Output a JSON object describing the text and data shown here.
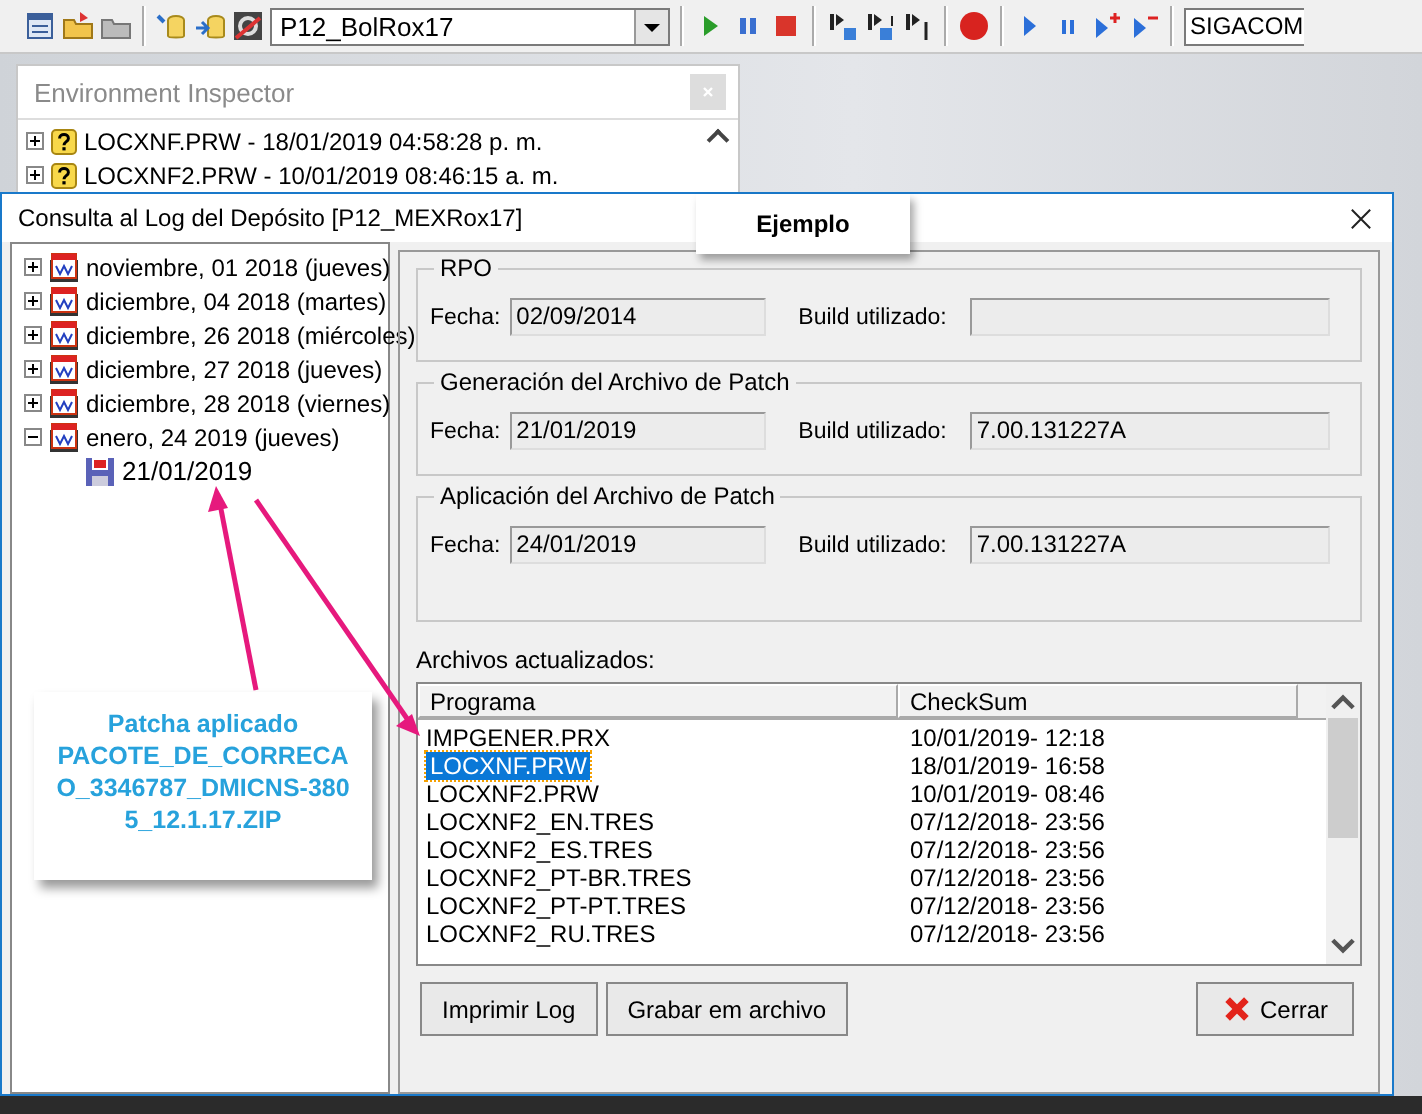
{
  "toolbar": {
    "environment_select": "P12_BolRox17",
    "server_field": "SIGACOM"
  },
  "environment_inspector": {
    "title": "Environment Inspector",
    "items": [
      {
        "label": "LOCXNF.PRW - 18/01/2019 04:58:28 p. m.",
        "expanded": false
      },
      {
        "label": "LOCXNF2.PRW - 10/01/2019 08:46:15 a. m.",
        "expanded": false
      }
    ]
  },
  "dialog": {
    "title": "Consulta al Log del Depósito [P12_MEXRox17]",
    "tree": [
      {
        "label": "noviembre, 01 2018 (jueves)",
        "expanded": false
      },
      {
        "label": "diciembre, 04 2018 (martes)",
        "expanded": false
      },
      {
        "label": "diciembre, 26 2018 (miércoles)",
        "expanded": false
      },
      {
        "label": "diciembre, 27 2018 (jueves)",
        "expanded": false
      },
      {
        "label": "diciembre, 28 2018 (viernes)",
        "expanded": false
      },
      {
        "label": "enero, 24 2019 (jueves)",
        "expanded": true,
        "children": [
          {
            "label": "21/01/2019"
          }
        ]
      }
    ],
    "groups": [
      {
        "title": "RPO",
        "date_label": "Fecha:",
        "date": "02/09/2014",
        "build_label": "Build utilizado:"
      },
      {
        "title": "Generación del Archivo de Patch",
        "date_label": "Fecha:",
        "date": "21/01/2019",
        "build_label": "Build utilizado:",
        "build": "7.00.131227A"
      },
      {
        "title": "Aplicación del Archivo de Patch",
        "date_label": "Fecha:",
        "date": "24/01/2019",
        "build_label": "Build utilizado:",
        "build": "7.00.131227A"
      }
    ],
    "files_label": "Archivos actualizados:",
    "table": {
      "columns": [
        "Programa",
        "CheckSum"
      ],
      "rows": [
        {
          "cells": [
            "IMPGENER.PRX",
            "10/01/2019- 12:18"
          ],
          "selected": false
        },
        {
          "cells": [
            "LOCXNF.PRW",
            "18/01/2019- 16:58"
          ],
          "selected": true
        },
        {
          "cells": [
            "LOCXNF2.PRW",
            "10/01/2019- 08:46"
          ],
          "selected": false
        },
        {
          "cells": [
            "LOCXNF2_EN.TRES",
            "07/12/2018- 23:56"
          ],
          "selected": false
        },
        {
          "cells": [
            "LOCXNF2_ES.TRES",
            "07/12/2018- 23:56"
          ],
          "selected": false
        },
        {
          "cells": [
            "LOCXNF2_PT-BR.TRES",
            "07/12/2018- 23:56"
          ],
          "selected": false
        },
        {
          "cells": [
            "LOCXNF2_PT-PT.TRES",
            "07/12/2018- 23:56"
          ],
          "selected": false
        },
        {
          "cells": [
            "LOCXNF2_RU.TRES",
            "07/12/2018- 23:56"
          ],
          "selected": false
        }
      ]
    },
    "buttons": [
      {
        "label": "Imprimir Log",
        "kind": "plain"
      },
      {
        "label": "Grabar em archivo",
        "kind": "plain"
      },
      {
        "label": "Cerrar",
        "kind": "close"
      }
    ]
  },
  "annotations": [
    {
      "kind": "tag",
      "text": "Ejemplo"
    },
    {
      "kind": "callout",
      "title": "Patcha aplicado",
      "text": "PACOTE_DE_CORRECAO_3346787_DMICNS-3805_12.1.17.ZIP"
    }
  ]
}
